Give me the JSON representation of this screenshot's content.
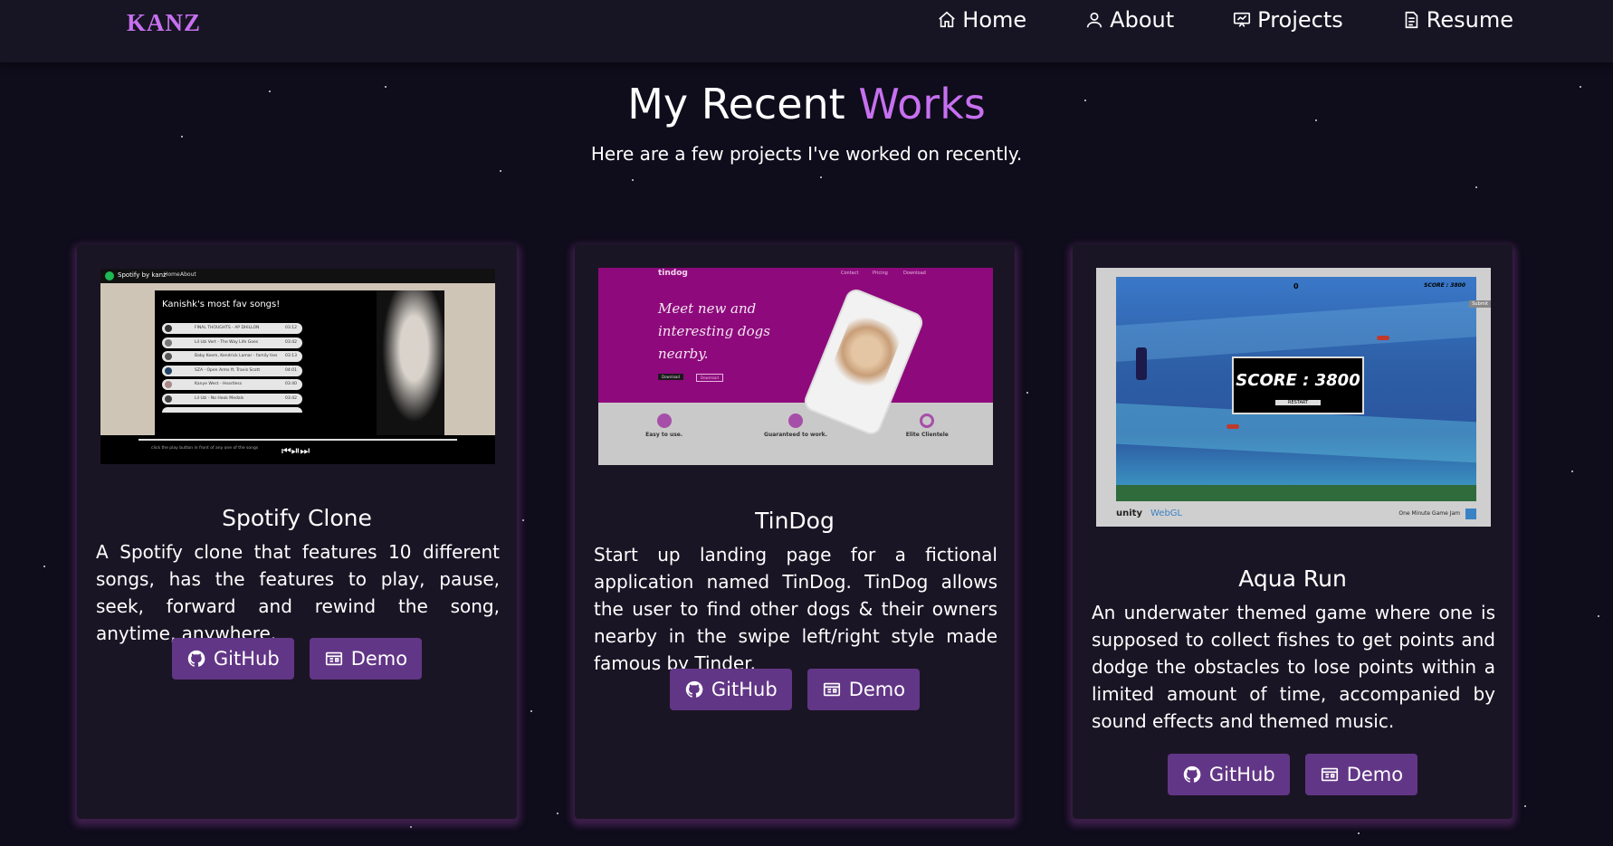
{
  "nav": {
    "logo": "KANZ",
    "items": [
      {
        "label": "Home",
        "icon": "home-icon"
      },
      {
        "label": "About",
        "icon": "user-icon"
      },
      {
        "label": "Projects",
        "icon": "projects-icon"
      },
      {
        "label": "Resume",
        "icon": "document-icon"
      }
    ]
  },
  "heading": {
    "title_prefix": "My Recent ",
    "title_accent": "Works",
    "subtitle": "Here are a few projects I've worked on recently."
  },
  "projects": [
    {
      "title": "Spotify Clone",
      "description": "A Spotify clone that features 10 different songs, has the features to play, pause, seek, forward and rewind the song, anytime, anywhere.",
      "github_label": "GitHub",
      "demo_label": "Demo",
      "preview": {
        "brand": "Spotify by kanz",
        "nav_home": "Home",
        "nav_about": "About",
        "playlist_title": "Kanishk's most fav songs!",
        "songs": [
          {
            "name": "FINAL THOUGHTS - AP DHILLON",
            "time": "03:12"
          },
          {
            "name": "Lil Uzi Vert - The Way Life Goes",
            "time": "03:42"
          },
          {
            "name": "Baby Keem, Kendrick Lamar - family ties",
            "time": "03:13"
          },
          {
            "name": "SZA - Open Arms ft. Travis Scott",
            "time": "04:01"
          },
          {
            "name": "Kanye West - Heartless",
            "time": "03:40"
          },
          {
            "name": "Lil Uzi - No Hook Medals",
            "time": "03:42"
          },
          {
            "name": "",
            "time": ""
          }
        ],
        "footer_hint": "click the play button in front of any one of the songs"
      }
    },
    {
      "title": "TinDog",
      "description": "Start up landing page for a fictional application named TinDog. TinDog allows the user to find other dogs & their owners nearby in the swipe left/right style made famous by Tinder.",
      "github_label": "GitHub",
      "demo_label": "Demo",
      "preview": {
        "brand": "tindog",
        "nav": [
          "Contact",
          "Pricing",
          "Download"
        ],
        "headline_1": "Meet new and",
        "headline_2": "interesting dogs",
        "headline_3": "nearby.",
        "btn_1": "Download",
        "btn_2": "Download",
        "feature_1": "Easy to use.",
        "feature_2": "Guaranteed to work.",
        "feature_3": "Elite Clientele",
        "accent": "#8e0a7c"
      }
    },
    {
      "title": "Aqua Run",
      "description": "An underwater themed game where one is supposed to collect fishes to get points and dodge the obstacles to lose points within a limited amount of time, accompanied by sound effects and themed music.",
      "github_label": "GitHub",
      "demo_label": "Demo",
      "preview": {
        "hud_score": "0",
        "hud_right": "SCORE : 3800",
        "submit": "Submit",
        "score_box": "SCORE : 3800",
        "restart": "RESTART",
        "unity": "unity",
        "webgl": "WebGL",
        "footer_right": "One Minute Game Jam"
      }
    }
  ],
  "colors": {
    "accent": "#c770f0",
    "button": "#623686",
    "card": "#1a1524",
    "background": "#0f0c1b"
  }
}
